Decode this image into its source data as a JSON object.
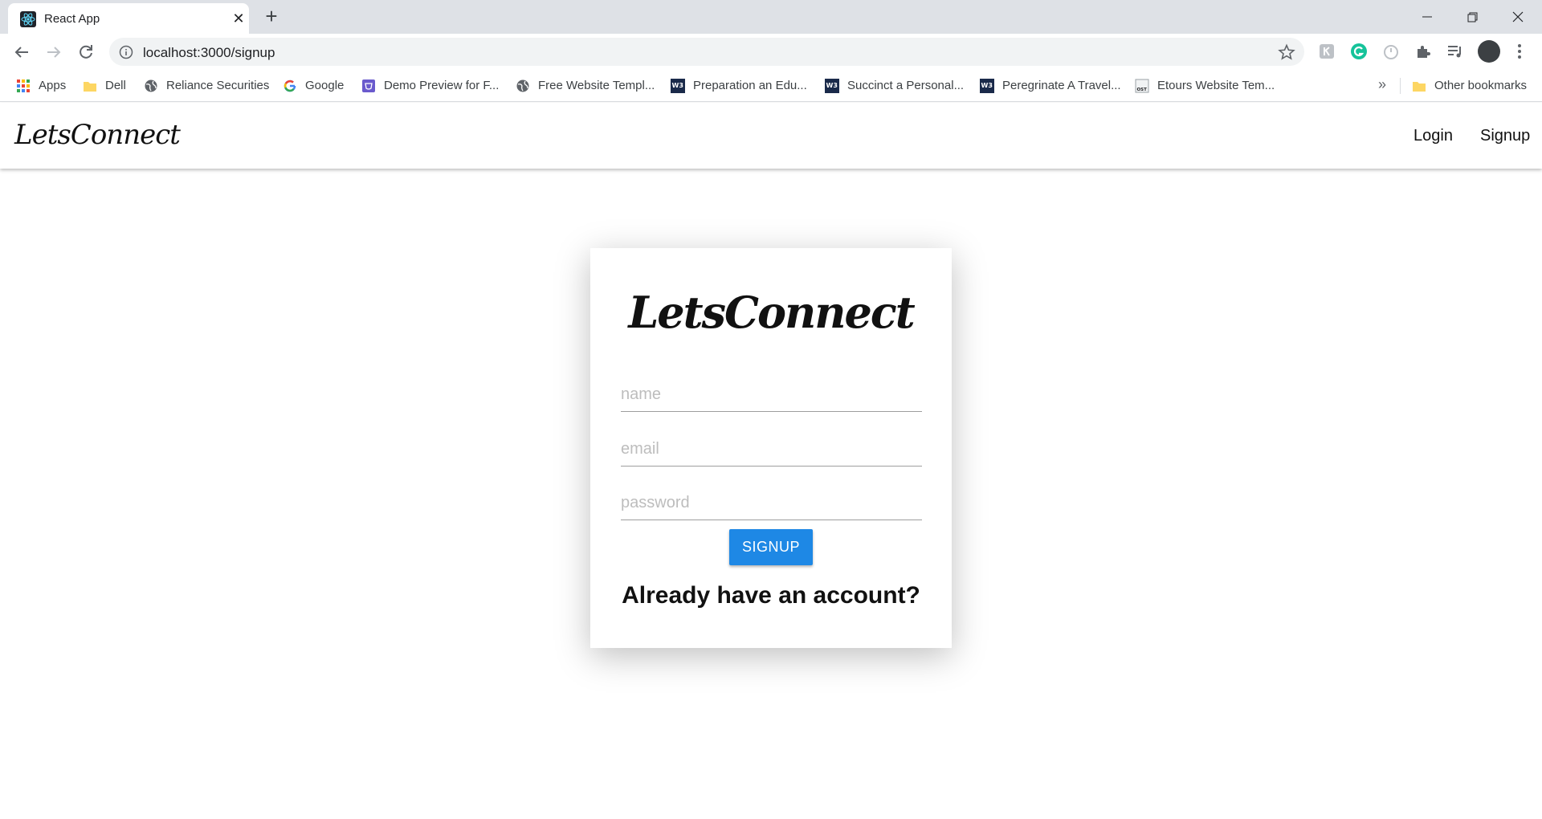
{
  "browser": {
    "tab_title": "React App",
    "tab_close": "✕",
    "new_tab": "+",
    "url": "localhost:3000/signup",
    "bookmarks": [
      {
        "label": "Apps",
        "icon": "apps-grid-icon"
      },
      {
        "label": "Dell",
        "icon": "folder-icon"
      },
      {
        "label": "Reliance Securities",
        "icon": "globe-icon"
      },
      {
        "label": "Google",
        "icon": "google-icon"
      },
      {
        "label": "Demo Preview for F...",
        "icon": "site-icon"
      },
      {
        "label": "Free Website Templ...",
        "icon": "globe-icon"
      },
      {
        "label": "Preparation an Edu...",
        "icon": "w3-icon"
      },
      {
        "label": "Succinct a Personal...",
        "icon": "w3-icon"
      },
      {
        "label": "Peregrinate A Travel...",
        "icon": "w3-icon"
      },
      {
        "label": "Etours Website Tem...",
        "icon": "ost-icon"
      }
    ],
    "more_bookmarks": "»",
    "other_bookmarks": "Other bookmarks"
  },
  "app": {
    "brand": "LetsConnect",
    "nav_login": "Login",
    "nav_signup": "Signup"
  },
  "signup": {
    "card_title": "LetsConnect",
    "name_placeholder": "name",
    "email_placeholder": "email",
    "password_placeholder": "password",
    "button_label": "SIGNUP",
    "already_text": "Already have an account?"
  },
  "colors": {
    "primary_button": "#1e88e5",
    "tabstrip": "#dee1e6"
  }
}
